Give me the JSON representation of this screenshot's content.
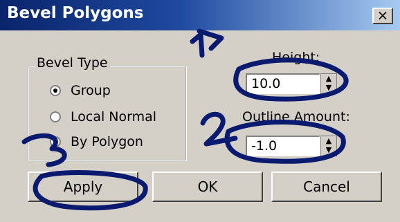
{
  "window": {
    "title": "Bevel Polygons",
    "close_glyph": "×"
  },
  "bevel_type": {
    "label": "Bevel Type",
    "options": [
      {
        "label": "Group",
        "checked": true
      },
      {
        "label": "Local Normal",
        "checked": false
      },
      {
        "label": "By Polygon",
        "checked": false
      }
    ]
  },
  "height": {
    "label": "Height:",
    "value": "10.0"
  },
  "outline_amount": {
    "label": "Outline Amount:",
    "value": "-1.0"
  },
  "buttons": {
    "apply": "Apply",
    "ok": "OK",
    "cancel": "Cancel"
  },
  "annotations": {
    "color": "#0a1a6e"
  },
  "icons": {
    "spinner": "spinner-arrows-icon",
    "close": "close-icon"
  }
}
